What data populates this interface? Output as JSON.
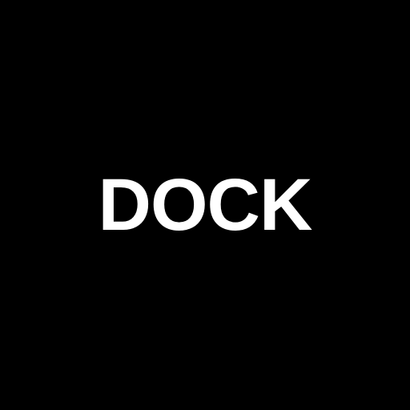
{
  "logo": {
    "text": "DOCK",
    "text_color": "#ffffff",
    "background_color": "#000000"
  }
}
